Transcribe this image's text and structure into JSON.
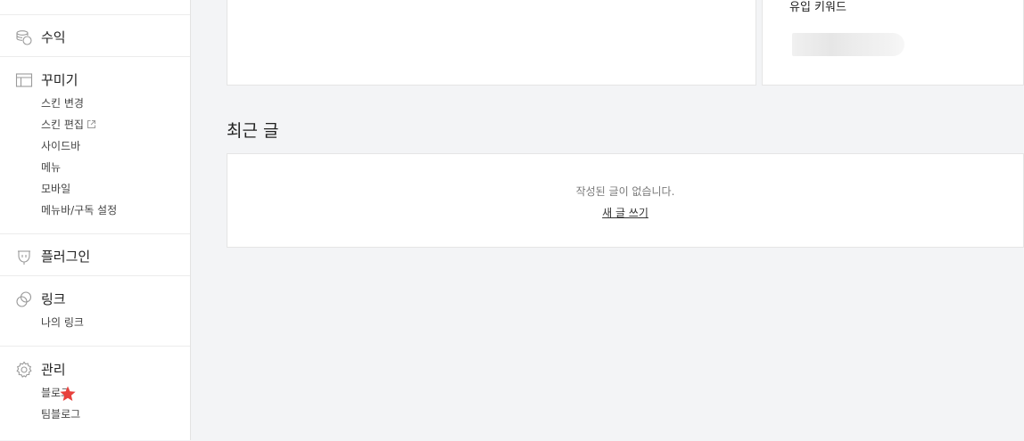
{
  "sidebar": {
    "revenue": {
      "title": "수익",
      "icon": "coins-icon"
    },
    "customize": {
      "title": "꾸미기",
      "icon": "layout-icon",
      "items": [
        "스킨 변경",
        "스킨 편집",
        "사이드바",
        "메뉴",
        "모바일",
        "메뉴바/구독 설정"
      ]
    },
    "plugins": {
      "title": "플러그인",
      "icon": "plug-icon"
    },
    "links": {
      "title": "링크",
      "icon": "link-icon",
      "items": [
        "나의 링크"
      ]
    },
    "manage": {
      "title": "관리",
      "icon": "gear-icon",
      "items": [
        "블로그",
        "팀블로그"
      ]
    }
  },
  "main": {
    "keyword_card": {
      "title": "유입 키워드"
    },
    "recent": {
      "title": "최근 글",
      "empty_message": "작성된 글이 없습니다.",
      "new_post": "새 글 쓰기"
    }
  },
  "colors": {
    "page_bg": "#f3f4f6",
    "card_bg": "#ffffff",
    "star": "#e8413d"
  }
}
